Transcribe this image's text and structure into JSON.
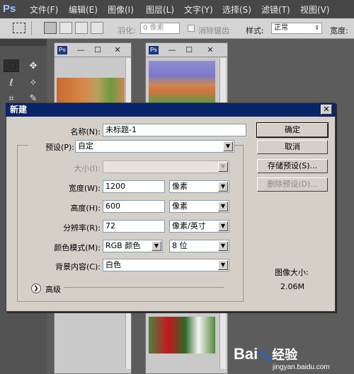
{
  "app": {
    "logo": "Ps"
  },
  "menu": [
    "文件(F)",
    "编辑(E)",
    "图像(I)",
    "图层(L)",
    "文字(Y)",
    "选择(S)",
    "滤镜(T)",
    "视图(V)"
  ],
  "options": {
    "feather_label": "羽化:",
    "feather_value": "0 像素",
    "antialias_label": "消除锯齿",
    "style_label": "样式:",
    "style_value": "正常",
    "width_label": "宽度:"
  },
  "tools": {
    "marquee": "⬚",
    "move": "✥",
    "lasso": "ℓ",
    "magic_wand": "✧",
    "crop": "⌗",
    "eyedropper": "✎"
  },
  "doc_windows": [
    {
      "icon": "Ps",
      "minimize": "—",
      "restore": "☐",
      "close": "✕"
    },
    {
      "icon": "Ps",
      "minimize": "—",
      "restore": "☐",
      "close": "✕"
    }
  ],
  "dialog": {
    "title": "新建",
    "close": "✕",
    "name_label": "名称(N):",
    "name_value": "未标题-1",
    "preset_label": "预设(P):",
    "preset_value": "自定",
    "size_label": "大小(I):",
    "size_value": "",
    "width_label": "宽度(W):",
    "width_value": "1200",
    "width_unit": "像素",
    "height_label": "高度(H):",
    "height_value": "600",
    "height_unit": "像素",
    "resolution_label": "分辨率(R):",
    "resolution_value": "72",
    "resolution_unit": "像素/英寸",
    "color_mode_label": "颜色模式(M):",
    "color_mode_value": "RGB 颜色",
    "bit_depth_value": "8 位",
    "background_label": "背景内容(C):",
    "background_value": "白色",
    "advanced_label": "高级",
    "ok_button": "确定",
    "cancel_button": "取消",
    "save_preset_button": "存储预设(S)...",
    "delete_preset_button": "删除预设(D)...",
    "image_size_label": "图像大小:",
    "image_size_value": "2.06M"
  },
  "watermark": {
    "brand": "Bai",
    "brand_suffix": "经验",
    "url": "jingyan.baidu.com"
  },
  "colors": {
    "title_bar": "#0a246a",
    "dialog_bg": "#d4d0c8",
    "workspace": "#5c5c5c"
  }
}
